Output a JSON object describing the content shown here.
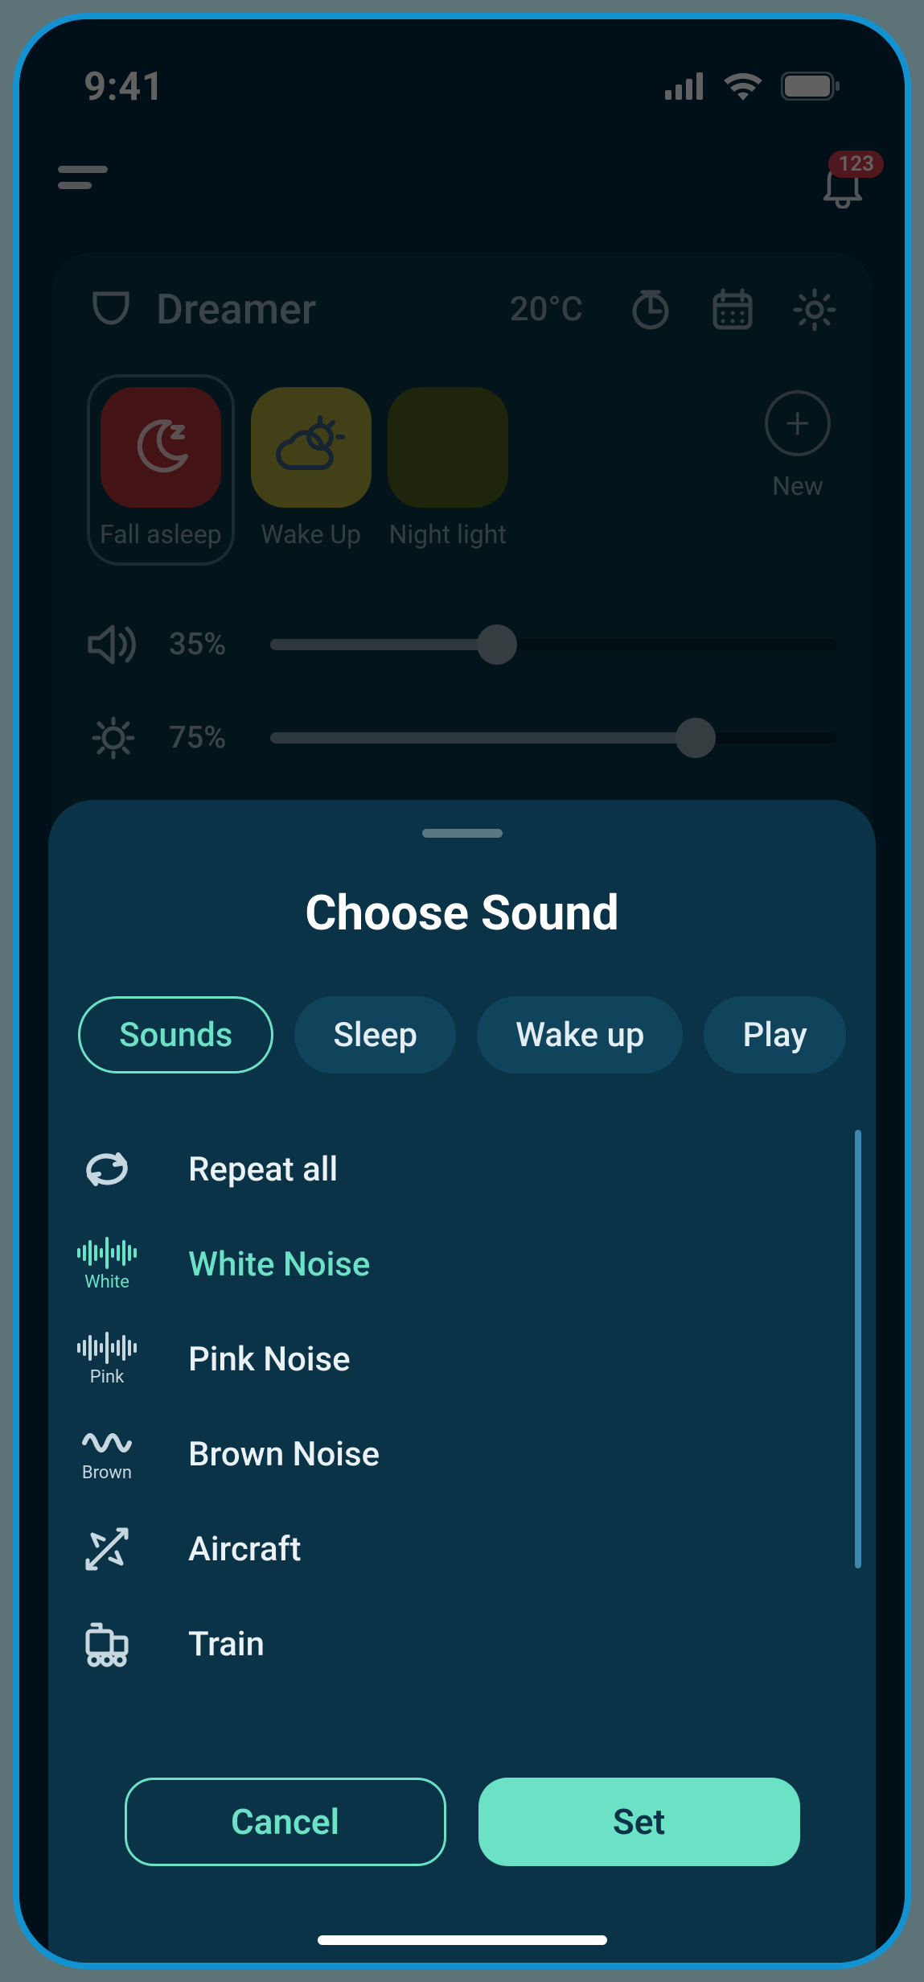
{
  "status": {
    "time": "9:41"
  },
  "nav": {
    "notification_count": "123"
  },
  "device": {
    "name": "Dreamer",
    "temperature": "20°C",
    "tiles": [
      {
        "label": "Fall asleep"
      },
      {
        "label": "Wake Up"
      },
      {
        "label": "Night light"
      }
    ],
    "new_label": "New",
    "volume": {
      "percent_label": "35%",
      "percent": 35
    },
    "brightness": {
      "percent_label": "75%",
      "percent": 75
    }
  },
  "sheet": {
    "title": "Choose Sound",
    "tabs": [
      {
        "label": "Sounds",
        "active": true
      },
      {
        "label": "Sleep"
      },
      {
        "label": "Wake up"
      },
      {
        "label": "Play"
      }
    ],
    "items": [
      {
        "label": "Repeat all",
        "icon": "repeat",
        "caption": ""
      },
      {
        "label": "White Noise",
        "icon": "wave",
        "caption": "White",
        "selected": true
      },
      {
        "label": "Pink Noise",
        "icon": "wave",
        "caption": "Pink"
      },
      {
        "label": "Brown Noise",
        "icon": "brown-wave",
        "caption": "Brown"
      },
      {
        "label": "Aircraft",
        "icon": "aircraft",
        "caption": ""
      },
      {
        "label": "Train",
        "icon": "train",
        "caption": ""
      }
    ],
    "cancel_label": "Cancel",
    "set_label": "Set"
  },
  "colors": {
    "accent": "#6be1c5"
  }
}
